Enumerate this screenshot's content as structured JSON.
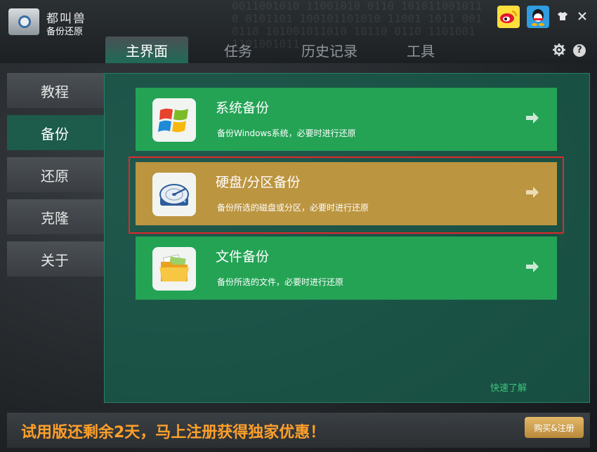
{
  "app": {
    "brand_top": "都叫兽",
    "brand_bottom": "备份还原"
  },
  "header": {
    "binary_deco": "0011001010 11001010 0110 1010110010110 0101101 100101101010 11001 1011 0010110 101001011010 10110 0110 1101001 1101001011",
    "tabs": [
      "主界面",
      "任务",
      "历史记录",
      "工具"
    ],
    "active_tab": "主界面"
  },
  "sidebar": {
    "items": [
      "教程",
      "备份",
      "还原",
      "克隆",
      "关于"
    ],
    "active": "备份"
  },
  "cards": [
    {
      "title": "系统备份",
      "desc": "备份Windows系统，必要时进行还原",
      "icon": "windows-logo-icon",
      "highlighted": false
    },
    {
      "title": "硬盘/分区备份",
      "desc": "备份所选的磁盘或分区，必要时进行还原",
      "icon": "hard-disk-icon",
      "highlighted": true
    },
    {
      "title": "文件备份",
      "desc": "备份所选的文件，必要时进行还原",
      "icon": "folder-icon",
      "highlighted": false
    }
  ],
  "quick_link": "快速了解",
  "footer": {
    "promo": "试用版还剩余2天，马上注册获得独家优惠！",
    "buy_label": "购买&注册"
  },
  "colors": {
    "card_green": "#24a355",
    "card_gold": "#bc9540",
    "highlight_red": "#e0282c",
    "promo_orange": "#ffa02a"
  }
}
